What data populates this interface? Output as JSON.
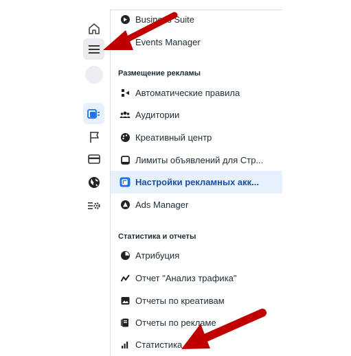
{
  "menu": {
    "top_items": [
      {
        "label": "Business Suite",
        "icon": "business-suite-icon"
      },
      {
        "label": "Events Manager",
        "icon": "events-manager-icon"
      }
    ],
    "section_ads": {
      "title": "Размещение рекламы",
      "items": [
        {
          "label": "Автоматические правила",
          "icon": "automated-rules-icon"
        },
        {
          "label": "Аудитории",
          "icon": "audiences-icon"
        },
        {
          "label": "Креативный центр",
          "icon": "creative-hub-icon"
        },
        {
          "label": "Лимиты объявлений для Стр...",
          "icon": "ad-limits-icon"
        },
        {
          "label": "Настройки рекламных акк...",
          "icon": "ad-account-settings-icon"
        },
        {
          "label": "Ads Manager",
          "icon": "ads-manager-icon"
        }
      ]
    },
    "section_stats": {
      "title": "Статистика и отчеты",
      "items": [
        {
          "label": "Атрибуция",
          "icon": "attribution-icon"
        },
        {
          "label": "Отчет \"Анализ трафика\"",
          "icon": "traffic-analysis-icon"
        },
        {
          "label": "Отчеты по креативам",
          "icon": "creative-reports-icon"
        },
        {
          "label": "Отчеты по рекламе",
          "icon": "ads-reports-icon"
        },
        {
          "label": "Статистика",
          "icon": "statistics-icon"
        }
      ]
    }
  },
  "rail": [
    "home-icon",
    "menu-icon",
    "avatar",
    "ad-accounts-icon",
    "flag-icon",
    "card-icon",
    "globe-icon",
    "settings-list-icon"
  ],
  "colors": {
    "accent": "#1a4fa3",
    "active_bg": "#e7f0fd",
    "arrow": "#c00000"
  }
}
